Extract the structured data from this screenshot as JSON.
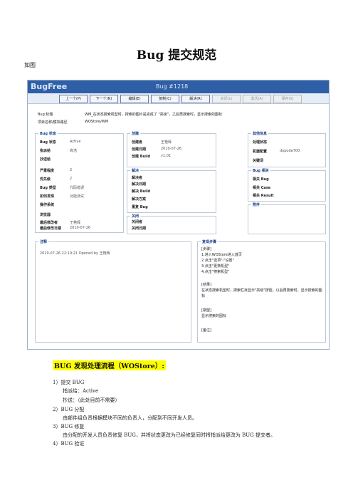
{
  "doc": {
    "title": "Bug 提交规范",
    "caption": "如图",
    "flow_title": "BUG 发现处理流程（WOStore）:",
    "lines": [
      "1）提交 BUG",
      "指派给：Active",
      "抄送：（此处目前不需要）",
      "2）BUG 分配",
      "由部件组负责根据模块不同的负责人，分配到不同开发人员。",
      "3）BUG 修复",
      "由分配的开发人员负责修复 BUG，并将状态更改为已经修复同时将指派给更改为 BUG 提交者。",
      "4）BUG 验证"
    ]
  },
  "shot": {
    "brand": "BugFree",
    "bug_id": "Bug #1218",
    "buttons": [
      "上一个(P)",
      "下一个(N)",
      "编辑(E)",
      "复制(C)",
      "解决(R)",
      "关闭(L)",
      "激活(A)",
      "保存(S)"
    ],
    "bug_title_label": "Bug 标题",
    "bug_title_value": "WM_在状态搜索机型时，搜索的图片是完成了 \"高级\"，之后再搜索时，显示搜索的图标",
    "project_label": "项目名称/模块路径",
    "project_value": "WOStore/WM",
    "status_box": {
      "title": "Bug 状态",
      "rows": [
        [
          "Bug 状态",
          "Active"
        ],
        [
          "指派给",
          "高浩"
        ],
        [
          "抄送给",
          ""
        ],
        [
          "严重程度",
          "2"
        ],
        [
          "优先级",
          "2"
        ],
        [
          "Bug 类型",
          "代码错误"
        ],
        [
          "如何发现",
          "功能测试"
        ],
        [
          "操作系统",
          ""
        ],
        [
          "浏览器",
          ""
        ],
        [
          "最后修改者",
          "王艳辉"
        ],
        [
          "最后修改日期",
          "2010-07-26"
        ]
      ]
    },
    "create_box": {
      "title": "创建",
      "rows": [
        [
          "创建者",
          "王艳辉"
        ],
        [
          "创建日期",
          "2010-07-26"
        ],
        [
          "创建 Build",
          "v1.01"
        ]
      ]
    },
    "resolve_box": {
      "title": "解决",
      "rows": [
        [
          "解决者",
          ""
        ],
        [
          "解决日期",
          ""
        ],
        [
          "解决 Build",
          ""
        ],
        [
          "解决方案",
          ""
        ],
        [
          "重复 Bug",
          ""
        ]
      ]
    },
    "close_box": {
      "title": "关闭",
      "rows": [
        [
          "关闭者",
          ""
        ],
        [
          "关闭日期",
          ""
        ]
      ]
    },
    "other_box": {
      "title": "其他信息",
      "rows": [
        [
          "处理状态",
          ""
        ],
        [
          "机器配置",
          "dopode700"
        ],
        [
          "关键词",
          ""
        ]
      ]
    },
    "related_box": {
      "title": "Bug 相关",
      "rows": [
        [
          "相关 Bug",
          ""
        ],
        [
          "相关 Case",
          ""
        ],
        [
          "相关 Result",
          ""
        ]
      ]
    },
    "attach_box": {
      "title": "附件"
    },
    "history_box": {
      "title": "注释",
      "entry": "2010-07-26 22:19:21 Opened by 王艳辉"
    },
    "steps_box": {
      "title": "复现步骤",
      "lines": [
        "[步骤]",
        "1.进入WOStore进入首页",
        "2.点击\"选项\"-\"设置\"",
        "3.点击\"更换机型\"",
        "4.点击\"搜索机型\"",
        "",
        "[结果]",
        "在状态搜索机型时，搜索栏目显示\"高级\"按钮，以后再搜索时，显示搜索的图",
        "标",
        "",
        "[期望]",
        "显示搜索的图标",
        "",
        "[备注]"
      ]
    }
  }
}
